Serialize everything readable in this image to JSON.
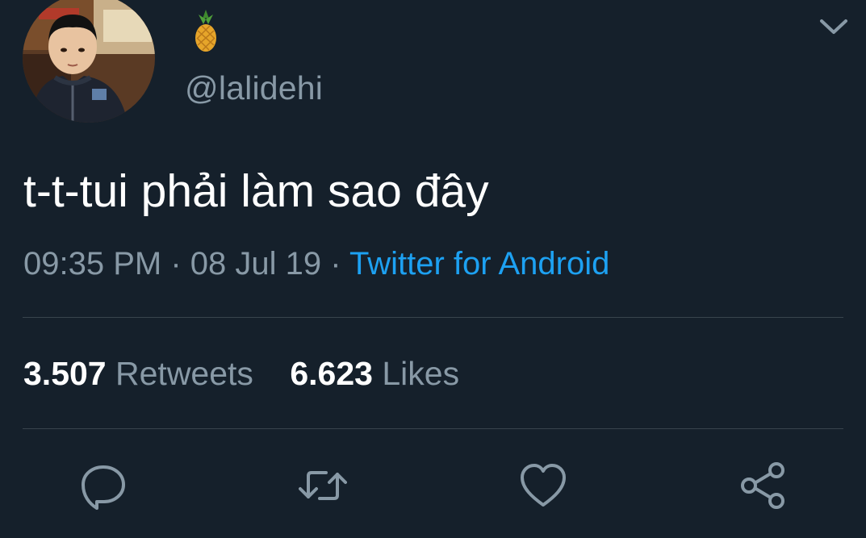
{
  "author": {
    "display_name_icon": "pineapple-emoji",
    "handle": "@lalidehi"
  },
  "tweet": {
    "text": "t-t-tui phải làm sao đây",
    "time": "09:35 PM",
    "separator": "·",
    "date": "08 Jul 19",
    "source": "Twitter for Android"
  },
  "stats": {
    "retweets_count": "3.507",
    "retweets_label": "Retweets",
    "likes_count": "6.623",
    "likes_label": "Likes"
  },
  "actions": [
    "reply-icon",
    "retweet-icon",
    "like-icon",
    "share-icon"
  ],
  "colors": {
    "background": "#15202b",
    "primary_text": "#ffffff",
    "secondary_text": "#8899a6",
    "link": "#1da1f2",
    "divider": "#38444d"
  }
}
